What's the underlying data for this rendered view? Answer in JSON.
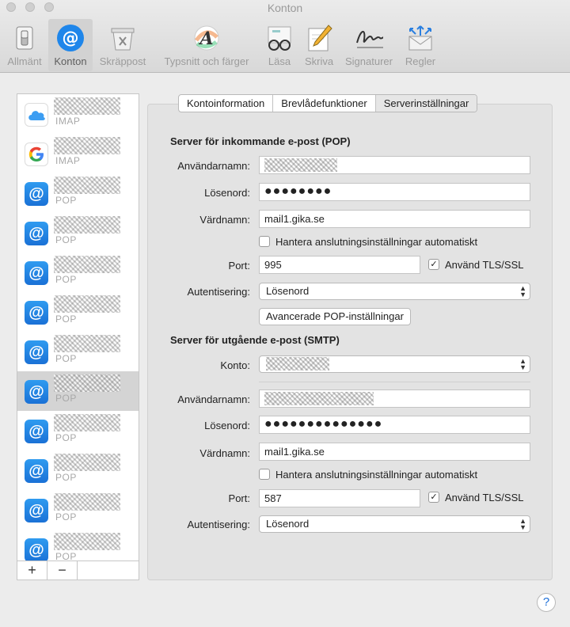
{
  "window": {
    "title": "Konton"
  },
  "toolbar": {
    "items": [
      {
        "label": "Allmänt",
        "icon": "switch-icon"
      },
      {
        "label": "Konton",
        "icon": "at-icon"
      },
      {
        "label": "Skräppost",
        "icon": "trash-icon"
      },
      {
        "label": "Typsnitt och färger",
        "icon": "font-icon"
      },
      {
        "label": "Läsa",
        "icon": "glasses-icon"
      },
      {
        "label": "Skriva",
        "icon": "pencil-icon"
      },
      {
        "label": "Signaturer",
        "icon": "signature-icon"
      },
      {
        "label": "Regler",
        "icon": "rules-icon"
      }
    ],
    "selected": "Konton"
  },
  "accounts": [
    {
      "type": "IMAP",
      "icon": "icloud-icon"
    },
    {
      "type": "IMAP",
      "icon": "google-icon"
    },
    {
      "type": "POP",
      "icon": "at-icon"
    },
    {
      "type": "POP",
      "icon": "at-icon"
    },
    {
      "type": "POP",
      "icon": "at-icon"
    },
    {
      "type": "POP",
      "icon": "at-icon"
    },
    {
      "type": "POP",
      "icon": "at-icon"
    },
    {
      "type": "POP",
      "icon": "at-icon",
      "selected": true
    },
    {
      "type": "POP",
      "icon": "at-icon"
    },
    {
      "type": "POP",
      "icon": "at-icon"
    },
    {
      "type": "POP",
      "icon": "at-icon"
    },
    {
      "type": "POP",
      "icon": "at-icon"
    }
  ],
  "list_buttons": {
    "add": "+",
    "remove": "−"
  },
  "tabs": [
    "Kontoinformation",
    "Brevlådefunktioner",
    "Serverinställningar"
  ],
  "active_tab": "Serverinställningar",
  "incoming": {
    "title": "Server för inkommande e-post (POP)",
    "username_label": "Användarnamn:",
    "password_label": "Lösenord:",
    "password_value": "●●●●●●●●",
    "host_label": "Värdnamn:",
    "host_value": "mail1.gika.se",
    "auto_manage_label": "Hantera anslutningsinställningar automatiskt",
    "auto_manage_checked": false,
    "port_label": "Port:",
    "port_value": "995",
    "tls_label": "Använd TLS/SSL",
    "tls_checked": true,
    "auth_label": "Autentisering:",
    "auth_value": "Lösenord",
    "advanced_button": "Avancerade POP-inställningar"
  },
  "outgoing": {
    "title": "Server för utgående e-post (SMTP)",
    "account_label": "Konto:",
    "username_label": "Användarnamn:",
    "password_label": "Lösenord:",
    "password_value": "●●●●●●●●●●●●●●",
    "host_label": "Värdnamn:",
    "host_value": "mail1.gika.se",
    "auto_manage_label": "Hantera anslutningsinställningar automatiskt",
    "auto_manage_checked": false,
    "port_label": "Port:",
    "port_value": "587",
    "tls_label": "Använd TLS/SSL",
    "tls_checked": true,
    "auth_label": "Autentisering:",
    "auth_value": "Lösenord"
  },
  "help_label": "?"
}
